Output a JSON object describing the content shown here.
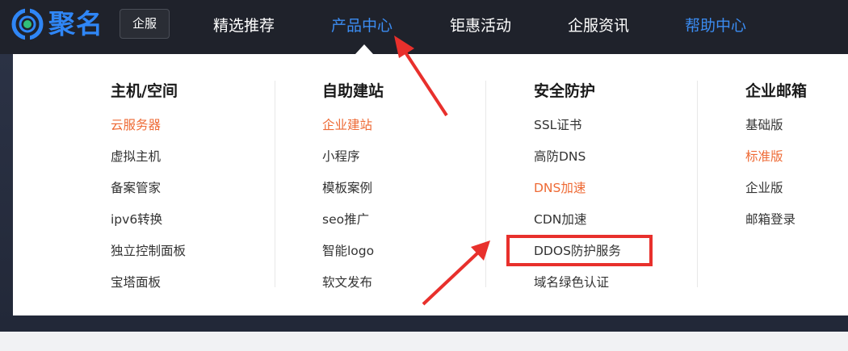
{
  "header": {
    "logo_text": "聚名",
    "qifu_label": "企服",
    "nav": [
      {
        "label": "精选推荐"
      },
      {
        "label": "产品中心"
      },
      {
        "label": "钜惠活动"
      },
      {
        "label": "企服资讯"
      },
      {
        "label": "帮助中心"
      }
    ]
  },
  "menu": {
    "columns": [
      {
        "title": "主机/空间",
        "items": [
          "云服务器",
          "虚拟主机",
          "备案管家",
          "ipv6转换",
          "独立控制面板",
          "宝塔面板"
        ]
      },
      {
        "title": "自助建站",
        "items": [
          "企业建站",
          "小程序",
          "模板案例",
          "seo推广",
          "智能logo",
          "软文发布"
        ]
      },
      {
        "title": "安全防护",
        "items": [
          "SSL证书",
          "高防DNS",
          "DNS加速",
          "CDN加速",
          "DDOS防护服务",
          "域名绿色认证"
        ]
      },
      {
        "title": "企业邮箱",
        "items": [
          "基础版",
          "标准版",
          "企业版",
          "邮箱登录"
        ]
      }
    ]
  },
  "colors": {
    "topbar": "#1f222b",
    "accent_blue": "#3b8cf2",
    "highlight_orange": "#ee6a35",
    "annotation_red": "#e8302c"
  }
}
